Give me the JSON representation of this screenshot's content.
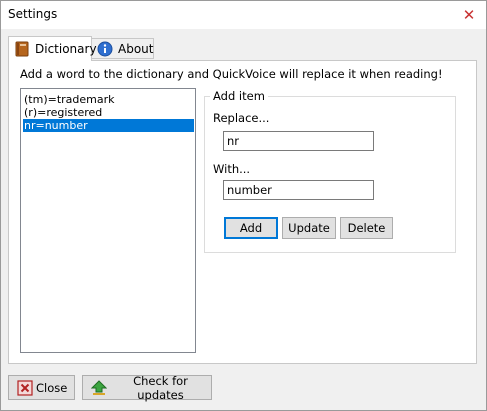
{
  "window": {
    "title": "Settings",
    "close_glyph": "✕"
  },
  "tabs": [
    {
      "label": "Dictionary",
      "icon": "book-icon",
      "selected": true
    },
    {
      "label": "About",
      "icon": "info-icon",
      "selected": false
    }
  ],
  "dictionary": {
    "instructions": "Add a word to the dictionary and QuickVoice will replace it when reading!",
    "entries": [
      {
        "text": "(tm)=trademark",
        "selected": false
      },
      {
        "text": "(r)=registered",
        "selected": false
      },
      {
        "text": "nr=number",
        "selected": true
      }
    ]
  },
  "add_item": {
    "legend": "Add item",
    "replace_label": "Replace...",
    "replace_value": "nr",
    "with_label": "With...",
    "with_value": "number",
    "buttons": {
      "add": "Add",
      "update": "Update",
      "delete": "Delete"
    }
  },
  "footer": {
    "close_label": "Close",
    "updates_label": "Check for updates"
  },
  "colors": {
    "selection": "#0078d7",
    "close_x": "#c83232"
  }
}
